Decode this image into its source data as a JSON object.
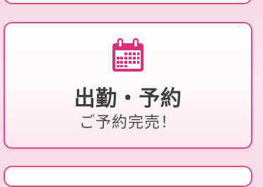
{
  "menu_card": {
    "title": "出勤・予約",
    "subtitle": "ご予約完売！",
    "icon": "calendar-icon"
  },
  "colors": {
    "accent": "#d8307a",
    "border": "#d8507f",
    "title_text": "#3d3d3d"
  }
}
